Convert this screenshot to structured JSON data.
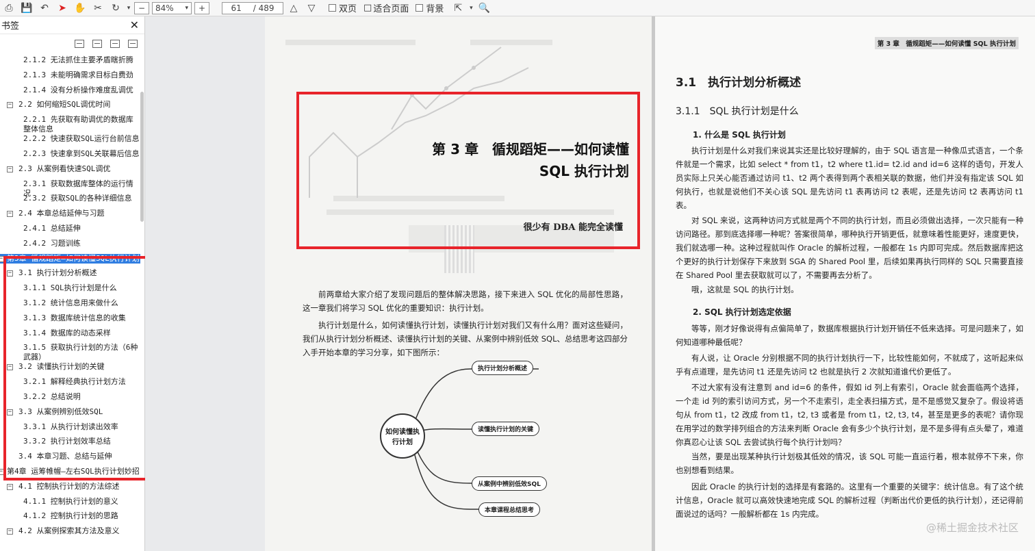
{
  "toolbar": {
    "zoom": "84%",
    "page_current": "61",
    "page_total": "/ 489",
    "double_page": "双页",
    "fit_page": "适合页面",
    "background": "背景"
  },
  "sidebar": {
    "title": "书签",
    "items": [
      {
        "label": "2.1.2 无法抓住主要矛盾瞎折腾",
        "level": 2
      },
      {
        "label": "2.1.3 未能明确需求目标白费劲",
        "level": 2
      },
      {
        "label": "2.1.4 没有分析操作难度乱调优",
        "level": 2
      },
      {
        "label": "2.2 如何缩短SQL调优时间",
        "level": 1,
        "exp": true
      },
      {
        "label": "2.2.1 先获取有助调优的数据库整体信息",
        "level": 2,
        "lines": 2
      },
      {
        "label": "2.2.2 快速获取SQL运行台前信息",
        "level": 2
      },
      {
        "label": "2.2.3 快速拿到SQL关联幕后信息",
        "level": 2
      },
      {
        "label": "2.3 从案例看快速SQL调优",
        "level": 1,
        "exp": true
      },
      {
        "label": "2.3.1 获取数据库整体的运行情况",
        "level": 2
      },
      {
        "label": "2.3.2 获取SQL的各种详细信息",
        "level": 2
      },
      {
        "label": "2.4 本章总结延伸与习题",
        "level": 1,
        "exp": true
      },
      {
        "label": "2.4.1 总结延伸",
        "level": 2
      },
      {
        "label": "2.4.2 习题训练",
        "level": 2
      },
      {
        "label": "第3章 循规蹈矩—如何读懂SQL执行计划",
        "level": 0,
        "exp": true,
        "selected": true
      },
      {
        "label": "3.1 执行计划分析概述",
        "level": 1,
        "exp": true
      },
      {
        "label": "3.1.1 SQL执行计划是什么",
        "level": 2
      },
      {
        "label": "3.1.2 统计信息用来做什么",
        "level": 2
      },
      {
        "label": "3.1.3 数据库统计信息的收集",
        "level": 2
      },
      {
        "label": "3.1.4 数据库的动态采样",
        "level": 2
      },
      {
        "label": "3.1.5 获取执行计划的方法（6种武器）",
        "level": 2,
        "lines": 2
      },
      {
        "label": "3.2 读懂执行计划的关键",
        "level": 1,
        "exp": true
      },
      {
        "label": "3.2.1 解释经典执行计划方法",
        "level": 2
      },
      {
        "label": "3.2.2 总结说明",
        "level": 2
      },
      {
        "label": "3.3 从案例辨别低效SQL",
        "level": 1,
        "exp": true
      },
      {
        "label": "3.3.1 从执行计划读出效率",
        "level": 2
      },
      {
        "label": "3.3.2 执行计划效率总结",
        "level": 2
      },
      {
        "label": "3.4 本章习题、总结与延伸",
        "level": 1
      },
      {
        "label": "第4章 运筹帷幄—左右SQL执行计划妙招",
        "level": 0,
        "exp": true
      },
      {
        "label": "4.1 控制执行计划的方法综述",
        "level": 1,
        "exp": true
      },
      {
        "label": "4.1.1 控制执行计划的意义",
        "level": 2
      },
      {
        "label": "4.1.2 控制执行计划的思路",
        "level": 2
      },
      {
        "label": "4.2 从案例探索其方法及意义",
        "level": 1,
        "exp": true
      }
    ]
  },
  "left_page": {
    "chapter_line1": "第 3 章　循规蹈矩——如何读懂",
    "chapter_line2": "SQL 执行计划",
    "quote": "很少有 DBA 能完全读懂",
    "para1": "前两章给大家介绍了发现问题后的整体解决思路，接下来进入 SQL 优化的局部性思路，这一章我们将学习 SQL 优化的重要知识：执行计划。",
    "para2": "执行计划是什么，如何读懂执行计划，读懂执行计划对我们又有什么用？面对这些疑问，我们从执行计划分析概述、读懂执行计划的关键、从案例中辨别低效 SQL、总结思考这四部分入手开始本章的学习分享，如下图所示：",
    "mindmap": {
      "center": "如何读懂执行计划",
      "branches": [
        "执行计划分析概述",
        "读懂执行计划的关键",
        "从案例中辨别低效SQL",
        "本章课程总结思考"
      ]
    }
  },
  "right_page": {
    "header": "第 3 章　循规蹈矩——如何读懂 SQL 执行计划",
    "h1": "3.1　执行计划分析概述",
    "h2": "3.1.1　SQL 执行计划是什么",
    "h3a": "1. 什么是 SQL 执行计划",
    "p1": "执行计划是什么对我们来说其实还是比较好理解的，由于 SQL 语言是一种像瓜式语言，一个条件就是一个需求，比如 select * from t1，t2 where t1.id= t2.id and id=6 这样的语句，开发人员实际上只关心能否通过访问 t1、t2 两个表得到两个表相关联的数据，他们并没有指定该 SQL 如何执行，也就是说他们不关心该 SQL 是先访问 t1 表再访问 t2 表呢，还是先访问 t2 表再访问 t1 表。",
    "p2": "对 SQL 来说，这两种访问方式就是两个不同的执行计划，而且必须做出选择，一次只能有一种访问路径。那到底选择哪一种呢？答案很简单，哪种执行开销更低，就意味着性能更好，速度更快，我们就选哪一种。这种过程就叫作 Oracle 的解析过程，一般都在 1s 内即可完成。然后数据库把这个更好的执行计划保存下来放到 SGA 的 Shared Pool 里，后续如果再执行同样的 SQL 只需要直接在 Shared Pool 里去获取就可以了，不需要再去分析了。",
    "p3": "哦，这就是 SQL 的执行计划。",
    "h3b": "2. SQL 执行计划选定依据",
    "p4": "等等，刚才好像说得有点偏简单了，数据库根据执行计划开销任不低来选择。可是问题来了，如何知道哪种最低呢？",
    "p5": "有人说，让 Oracle 分别根据不同的执行计划执行一下，比较性能如何，不就成了，这听起来似乎有点道理，是先访问 t1 还是先访问 t2 也就是执行 2 次就知道谁代价更低了。",
    "p6": "不过大家有没有注意到 and id=6 的条件，假如 id 列上有索引，Oracle 就会面临两个选择，一个走 id 列的索引访问方式，另一个不走索引，走全表扫描方式，是不是感觉又复杂了。假设将语句从 from t1，t2 改成 from t1，t2, t3 或者是 from t1，t2, t3, t4，甚至是更多的表呢？请你现在用学过的数学排列组合的方法来判断 Oracle 会有多少个执行计划，是不是多得有点头晕了，难道你真忍心让该 SQL 去尝试执行每个执行计划吗？",
    "p7": "当然，要是出现某种执行计划极其低效的情况，该 SQL 可能一直运行着，根本就停不下来，你也别想看到结果。",
    "p8": "因此 Oracle 的执行计划的选择是有套路的。这里有一个重要的关键字：统计信息。有了这个统计信息，Oracle 就可以高效快速地完成 SQL 的解析过程（判断出代价更低的执行计划），还记得前面说过的话吗？一般解析都在 1s 内完成。",
    "watermark": "@稀土掘金技术社区"
  },
  "colors": {
    "highlight_box": "#e8242b",
    "selection": "#2f7de1"
  }
}
